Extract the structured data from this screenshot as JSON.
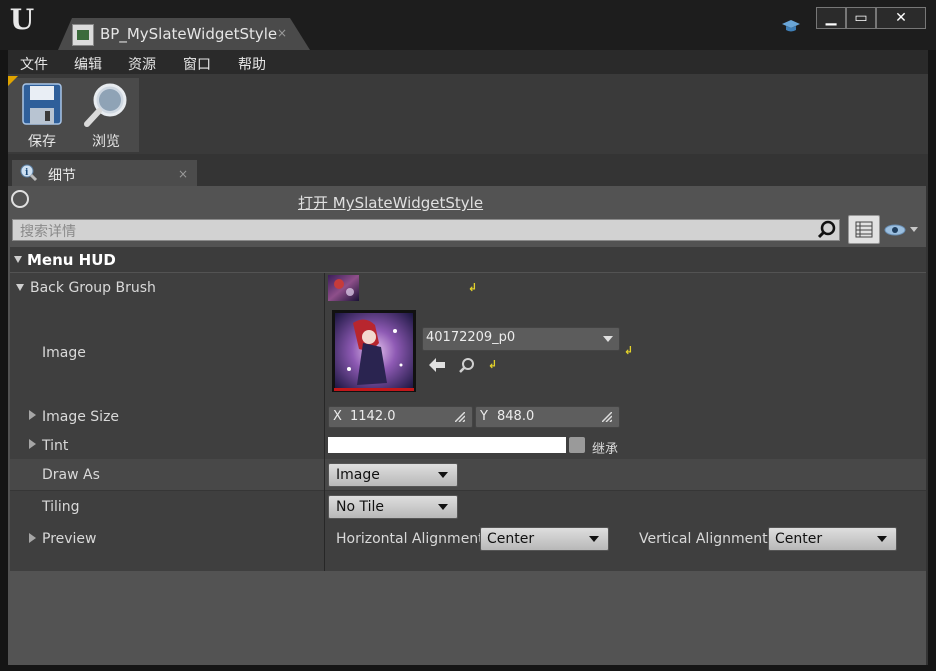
{
  "window": {
    "tab_title": "BP_MySlateWidgetStyle",
    "tab_close": "×",
    "minimize": "▁",
    "maximize": "▭",
    "close": "✕"
  },
  "menu": [
    "文件",
    "编辑",
    "资源",
    "窗口",
    "帮助"
  ],
  "toolbar": {
    "save_label": "保存",
    "browse_label": "浏览"
  },
  "details": {
    "tab_label": "细节",
    "tab_close": "×",
    "open_link": "打开 MySlateWidgetStyle",
    "search_placeholder": "搜索详情",
    "category": "Menu HUD",
    "back_group_brush": "Back Group Brush",
    "image_label": "Image",
    "image_asset": "40172209_p0",
    "image_size_label": "Image Size",
    "image_size_x_label": "X",
    "image_size_x": "1142.0",
    "image_size_y_label": "Y",
    "image_size_y": "848.0",
    "tint_label": "Tint",
    "tint_color": "#ffffff",
    "inherit_label": "继承",
    "draw_as_label": "Draw As",
    "draw_as_value": "Image",
    "tiling_label": "Tiling",
    "tiling_value": "No Tile",
    "preview_label": "Preview",
    "h_align_label": "Horizontal Alignment",
    "h_align_value": "Center",
    "v_align_label": "Vertical Alignment",
    "v_align_value": "Center"
  },
  "colors": {
    "accent": "#e0a400",
    "reset_arrow": "#e3d22a",
    "image_underline": "#c2171a"
  }
}
